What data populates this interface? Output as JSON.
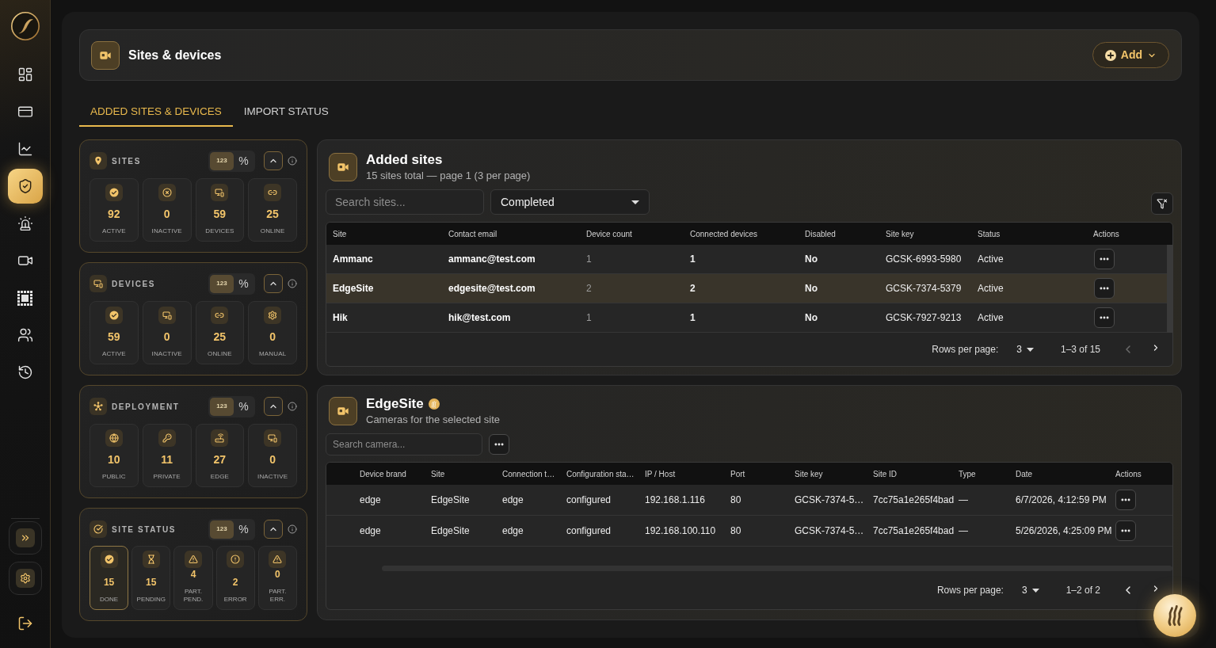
{
  "sidebar": {
    "items": [
      {
        "selected": false
      },
      {
        "selected": false
      },
      {
        "selected": false
      },
      {
        "selected": true
      },
      {
        "selected": false
      },
      {
        "selected": false
      },
      {
        "selected": false
      },
      {
        "selected": false
      },
      {
        "selected": false
      }
    ]
  },
  "header": {
    "title": "Sites & devices",
    "add_button": "Add"
  },
  "tabs": [
    {
      "label": "ADDED SITES & DEVICES",
      "selected": true
    },
    {
      "label": "IMPORT STATUS",
      "selected": false
    }
  ],
  "stat_cards": [
    {
      "title": "SITES",
      "expanded": true,
      "view_toggle": [
        {
          "label": "123",
          "selected": true
        },
        {
          "label": "%",
          "selected": false
        }
      ],
      "tiles": [
        {
          "value": "92",
          "label": "ACTIVE"
        },
        {
          "value": "0",
          "label": "INACTIVE"
        },
        {
          "value": "59",
          "label": "DEVICES"
        },
        {
          "value": "25",
          "label": "ONLINE"
        }
      ]
    },
    {
      "title": "DEVICES",
      "expanded": true,
      "view_toggle": [
        {
          "label": "123",
          "selected": true
        },
        {
          "label": "%",
          "selected": false
        }
      ],
      "tiles": [
        {
          "value": "59",
          "label": "ACTIVE"
        },
        {
          "value": "0",
          "label": "INACTIVE"
        },
        {
          "value": "25",
          "label": "ONLINE"
        },
        {
          "value": "0",
          "label": "MANUAL"
        }
      ]
    },
    {
      "title": "DEPLOYMENT",
      "expanded": true,
      "view_toggle": [
        {
          "label": "123",
          "selected": true
        },
        {
          "label": "%",
          "selected": false
        }
      ],
      "tiles": [
        {
          "value": "10",
          "label": "PUBLIC"
        },
        {
          "value": "11",
          "label": "PRIVATE"
        },
        {
          "value": "27",
          "label": "EDGE"
        },
        {
          "value": "0",
          "label": "INACTIVE"
        }
      ]
    },
    {
      "title": "SITE STATUS",
      "expanded": true,
      "view_toggle": [
        {
          "label": "123",
          "selected": true
        },
        {
          "label": "%",
          "selected": false
        }
      ],
      "tiles": [
        {
          "value": "15",
          "label": "DONE",
          "selected": true
        },
        {
          "value": "15",
          "label": "PENDING",
          "selected": false
        },
        {
          "value": "4",
          "label": "PART. PEND.",
          "selected": false
        },
        {
          "value": "2",
          "label": "ERROR",
          "selected": false
        },
        {
          "value": "0",
          "label": "PART. ERR.",
          "selected": false
        }
      ]
    }
  ],
  "sites_panel": {
    "title": "Added sites",
    "subtitle": "15 sites total — page 1 (3 per page)",
    "search": {
      "placeholder": "Search sites..."
    },
    "status_filter": {
      "value": "Completed"
    },
    "table": {
      "columns": [
        {
          "label": "Site",
          "kind": "bold"
        },
        {
          "label": "Contact email",
          "kind": "bold"
        },
        {
          "label": "Device count",
          "kind": "muted"
        },
        {
          "label": "Connected devices",
          "kind": "medium"
        },
        {
          "label": "Disabled",
          "kind": "medium"
        },
        {
          "label": "Site key",
          "kind": "text"
        },
        {
          "label": "Status",
          "kind": "text"
        },
        {
          "label": "Actions",
          "kind": "actions"
        }
      ],
      "rows": [
        {
          "cells": [
            "Ammanc",
            "ammanc@test.com",
            "1",
            "1",
            "No",
            "GCSK-6993-5980",
            "Active"
          ],
          "selected": false
        },
        {
          "cells": [
            "EdgeSite",
            "edgesite@test.com",
            "2",
            "2",
            "No",
            "GCSK-7374-5379",
            "Active"
          ],
          "selected": true
        },
        {
          "cells": [
            "Hik",
            "hik@test.com",
            "1",
            "1",
            "No",
            "GCSK-7927-9213",
            "Active"
          ],
          "selected": false
        }
      ]
    },
    "pagination": {
      "rows_label": "Rows per page:",
      "rows_value": "3",
      "range": "1–3 of 15",
      "previous": {
        "disabled": true
      },
      "next": {
        "disabled": false
      }
    }
  },
  "cameras_panel": {
    "title": "EdgeSite",
    "subtitle": "Cameras for the selected site",
    "search": {
      "placeholder": "Search camera..."
    },
    "table": {
      "columns": [
        {
          "label": "Device brand",
          "kind": "text"
        },
        {
          "label": "Site",
          "kind": "text"
        },
        {
          "label": "Connection t…",
          "kind": "text"
        },
        {
          "label": "Configuration sta…",
          "kind": "text"
        },
        {
          "label": "IP / Host",
          "kind": "text"
        },
        {
          "label": "Port",
          "kind": "text"
        },
        {
          "label": "Site key",
          "kind": "text"
        },
        {
          "label": "Site ID",
          "kind": "text"
        },
        {
          "label": "Type",
          "kind": "text"
        },
        {
          "label": "Date",
          "kind": "text"
        },
        {
          "label": "Actions",
          "kind": "actions"
        }
      ],
      "rows": [
        {
          "cells": [
            "edge",
            "EdgeSite",
            "edge",
            "configured",
            "192.168.1.116",
            "80",
            "GCSK-7374-5…",
            "7cc75a1e265f4bad",
            "—",
            "6/7/2026, 4:12:59 PM"
          ]
        },
        {
          "cells": [
            "edge",
            "EdgeSite",
            "edge",
            "configured",
            "192.168.100.110",
            "80",
            "GCSK-7374-5…",
            "7cc75a1e265f4bad",
            "—",
            "5/26/2026, 4:25:09 PM"
          ]
        }
      ]
    },
    "pagination": {
      "rows_label": "Rows per page:",
      "rows_value": "3",
      "range": "1–2 of 2",
      "previous": {
        "disabled": false
      },
      "next": {
        "disabled": false
      }
    }
  }
}
